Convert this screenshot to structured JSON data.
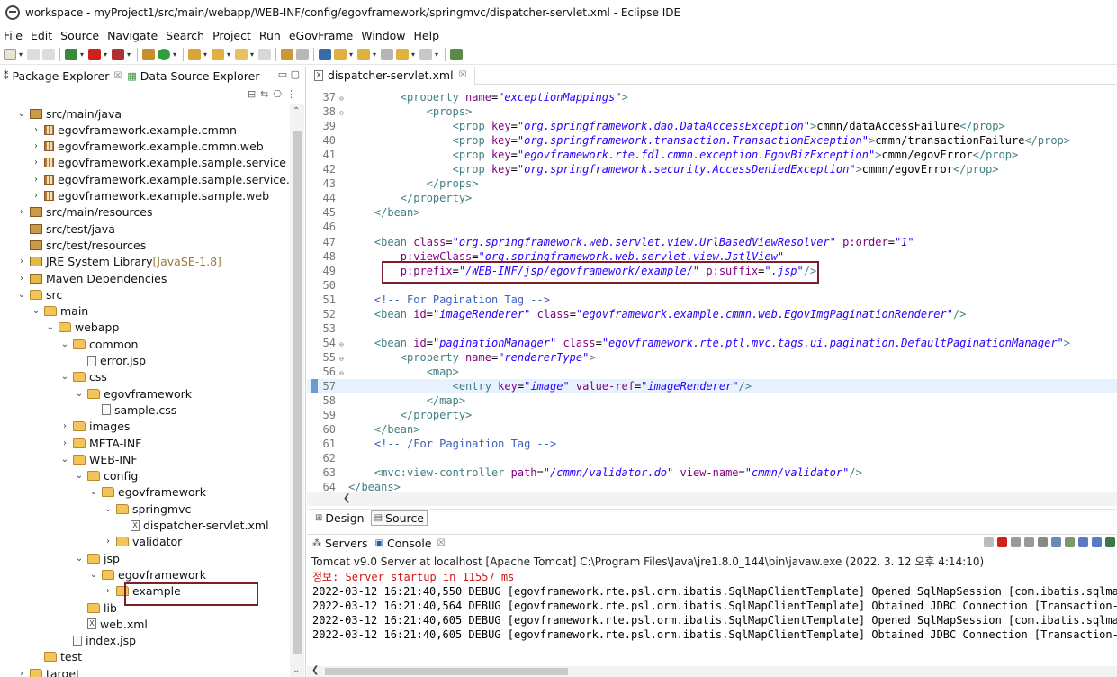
{
  "window": {
    "title": "workspace - myProject1/src/main/webapp/WEB-INF/config/egovframework/springmvc/dispatcher-servlet.xml - Eclipse IDE"
  },
  "menu": [
    "File",
    "Edit",
    "Source",
    "Navigate",
    "Search",
    "Project",
    "Run",
    "eGovFrame",
    "Window",
    "Help"
  ],
  "left_panel": {
    "tabs": [
      {
        "label": "Package Explorer",
        "icon": "package-explorer-icon"
      },
      {
        "label": "Data Source Explorer",
        "icon": "data-source-icon"
      }
    ],
    "tree": [
      {
        "label": "src/main/java",
        "chev": "v",
        "icon": "source-folder",
        "indent": 0
      },
      {
        "label": "egovframework.example.cmmn",
        "chev": ">",
        "icon": "package",
        "indent": 1
      },
      {
        "label": "egovframework.example.cmmn.web",
        "chev": ">",
        "icon": "package",
        "indent": 1
      },
      {
        "label": "egovframework.example.sample.service",
        "chev": ">",
        "icon": "package",
        "indent": 1
      },
      {
        "label": "egovframework.example.sample.service.impl",
        "chev": ">",
        "icon": "package",
        "indent": 1
      },
      {
        "label": "egovframework.example.sample.web",
        "chev": ">",
        "icon": "package",
        "indent": 1
      },
      {
        "label": "src/main/resources",
        "chev": ">",
        "icon": "source-folder",
        "indent": 0
      },
      {
        "label": "src/test/java",
        "chev": "",
        "icon": "source-folder",
        "indent": 0
      },
      {
        "label": "src/test/resources",
        "chev": "",
        "icon": "source-folder",
        "indent": 0
      },
      {
        "label": "JRE System Library",
        "suffix": " [JavaSE-1.8]",
        "chev": ">",
        "icon": "library",
        "indent": 0
      },
      {
        "label": "Maven Dependencies",
        "chev": ">",
        "icon": "library",
        "indent": 0
      },
      {
        "label": "src",
        "chev": "v",
        "icon": "folder",
        "indent": 0
      },
      {
        "label": "main",
        "chev": "v",
        "icon": "folder",
        "indent": 1
      },
      {
        "label": "webapp",
        "chev": "v",
        "icon": "folder",
        "indent": 2
      },
      {
        "label": "common",
        "chev": "v",
        "icon": "folder",
        "indent": 3
      },
      {
        "label": "error.jsp",
        "chev": "",
        "icon": "file",
        "indent": 4
      },
      {
        "label": "css",
        "chev": "v",
        "icon": "folder",
        "indent": 3
      },
      {
        "label": "egovframework",
        "chev": "v",
        "icon": "folder",
        "indent": 4
      },
      {
        "label": "sample.css",
        "chev": "",
        "icon": "file",
        "indent": 5
      },
      {
        "label": "images",
        "chev": ">",
        "icon": "folder",
        "indent": 3
      },
      {
        "label": "META-INF",
        "chev": ">",
        "icon": "folder",
        "indent": 3
      },
      {
        "label": "WEB-INF",
        "chev": "v",
        "icon": "folder",
        "indent": 3
      },
      {
        "label": "config",
        "chev": "v",
        "icon": "folder",
        "indent": 4
      },
      {
        "label": "egovframework",
        "chev": "v",
        "icon": "folder",
        "indent": 5
      },
      {
        "label": "springmvc",
        "chev": "v",
        "icon": "folder",
        "indent": 6
      },
      {
        "label": "dispatcher-servlet.xml",
        "chev": "",
        "icon": "xml",
        "indent": 7
      },
      {
        "label": "validator",
        "chev": ">",
        "icon": "folder",
        "indent": 6
      },
      {
        "label": "jsp",
        "chev": "v",
        "icon": "folder",
        "indent": 4
      },
      {
        "label": "egovframework",
        "chev": "v",
        "icon": "folder",
        "indent": 5
      },
      {
        "label": "example",
        "chev": ">",
        "icon": "folder",
        "indent": 6
      },
      {
        "label": "lib",
        "chev": "",
        "icon": "folder",
        "indent": 4
      },
      {
        "label": "web.xml",
        "chev": "",
        "icon": "xml",
        "indent": 4
      },
      {
        "label": "index.jsp",
        "chev": "",
        "icon": "file",
        "indent": 3
      },
      {
        "label": "test",
        "chev": "",
        "icon": "folder",
        "indent": 1
      },
      {
        "label": "target",
        "chev": ">",
        "icon": "folder",
        "indent": 0
      }
    ]
  },
  "editor": {
    "tab_label": "dispatcher-servlet.xml",
    "lines": [
      {
        "n": "37",
        "fold": "⊖",
        "segs": [
          [
            "code",
            "        "
          ],
          [
            "tag",
            "<property "
          ],
          [
            "attr",
            "name"
          ],
          [
            "code",
            "="
          ],
          [
            "val",
            "\"exceptionMappings\""
          ],
          [
            "tag",
            ">"
          ]
        ]
      },
      {
        "n": "38",
        "fold": "⊖",
        "segs": [
          [
            "code",
            "            "
          ],
          [
            "tag",
            "<props>"
          ]
        ]
      },
      {
        "n": "39",
        "fold": "",
        "segs": [
          [
            "code",
            "                "
          ],
          [
            "tag",
            "<prop "
          ],
          [
            "attr",
            "key"
          ],
          [
            "code",
            "="
          ],
          [
            "val",
            "\"org.springframework.dao.DataAccessException\""
          ],
          [
            "tag",
            ">"
          ],
          [
            "code",
            "cmmn/dataAccessFailure"
          ],
          [
            "tag",
            "</prop>"
          ]
        ]
      },
      {
        "n": "40",
        "fold": "",
        "segs": [
          [
            "code",
            "                "
          ],
          [
            "tag",
            "<prop "
          ],
          [
            "attr",
            "key"
          ],
          [
            "code",
            "="
          ],
          [
            "val",
            "\"org.springframework.transaction.TransactionException\""
          ],
          [
            "tag",
            ">"
          ],
          [
            "code",
            "cmmn/transactionFailure"
          ],
          [
            "tag",
            "</prop>"
          ]
        ]
      },
      {
        "n": "41",
        "fold": "",
        "segs": [
          [
            "code",
            "                "
          ],
          [
            "tag",
            "<prop "
          ],
          [
            "attr",
            "key"
          ],
          [
            "code",
            "="
          ],
          [
            "val",
            "\"egovframework.rte.fdl.cmmn.exception.EgovBizException\""
          ],
          [
            "tag",
            ">"
          ],
          [
            "code",
            "cmmn/egovError"
          ],
          [
            "tag",
            "</prop>"
          ]
        ]
      },
      {
        "n": "42",
        "fold": "",
        "segs": [
          [
            "code",
            "                "
          ],
          [
            "tag",
            "<prop "
          ],
          [
            "attr",
            "key"
          ],
          [
            "code",
            "="
          ],
          [
            "val",
            "\"org.springframework.security.AccessDeniedException\""
          ],
          [
            "tag",
            ">"
          ],
          [
            "code",
            "cmmn/egovError"
          ],
          [
            "tag",
            "</prop>"
          ]
        ]
      },
      {
        "n": "43",
        "fold": "",
        "segs": [
          [
            "code",
            "            "
          ],
          [
            "tag",
            "</props>"
          ]
        ]
      },
      {
        "n": "44",
        "fold": "",
        "segs": [
          [
            "code",
            "        "
          ],
          [
            "tag",
            "</property>"
          ]
        ]
      },
      {
        "n": "45",
        "fold": "",
        "segs": [
          [
            "code",
            "    "
          ],
          [
            "tag",
            "</bean>"
          ]
        ]
      },
      {
        "n": "46",
        "fold": "",
        "segs": [
          [
            "code",
            ""
          ]
        ]
      },
      {
        "n": "47",
        "fold": "",
        "segs": [
          [
            "code",
            "    "
          ],
          [
            "tag",
            "<bean "
          ],
          [
            "attr",
            "class"
          ],
          [
            "code",
            "="
          ],
          [
            "val",
            "\"org.springframework.web.servlet.view.UrlBasedViewResolver\""
          ],
          [
            "code",
            " "
          ],
          [
            "attr",
            "p:order"
          ],
          [
            "code",
            "="
          ],
          [
            "val",
            "\"1\""
          ]
        ]
      },
      {
        "n": "48",
        "fold": "",
        "segs": [
          [
            "code",
            "        "
          ],
          [
            "attr",
            "p:viewClass"
          ],
          [
            "code",
            "="
          ],
          [
            "val",
            "\"org.springframework.web.servlet.view.JstlView\""
          ]
        ]
      },
      {
        "n": "49",
        "fold": "",
        "segs": [
          [
            "code",
            "        "
          ],
          [
            "attr",
            "p:prefix"
          ],
          [
            "code",
            "="
          ],
          [
            "val",
            "\"/WEB-INF/jsp/egovframework/example/\""
          ],
          [
            "code",
            " "
          ],
          [
            "attr",
            "p:suffix"
          ],
          [
            "code",
            "="
          ],
          [
            "val",
            "\".jsp\""
          ],
          [
            "tag",
            "/>"
          ]
        ]
      },
      {
        "n": "50",
        "fold": "",
        "segs": [
          [
            "code",
            ""
          ]
        ]
      },
      {
        "n": "51",
        "fold": "",
        "segs": [
          [
            "code",
            "    "
          ],
          [
            "cmt",
            "<!-- For Pagination Tag -->"
          ]
        ]
      },
      {
        "n": "52",
        "fold": "",
        "segs": [
          [
            "code",
            "    "
          ],
          [
            "tag",
            "<bean "
          ],
          [
            "attr",
            "id"
          ],
          [
            "code",
            "="
          ],
          [
            "val",
            "\"imageRenderer\""
          ],
          [
            "code",
            " "
          ],
          [
            "attr",
            "class"
          ],
          [
            "code",
            "="
          ],
          [
            "val",
            "\"egovframework.example.cmmn.web.EgovImgPaginationRenderer\""
          ],
          [
            "tag",
            "/>"
          ]
        ]
      },
      {
        "n": "53",
        "fold": "",
        "segs": [
          [
            "code",
            ""
          ]
        ]
      },
      {
        "n": "54",
        "fold": "⊖",
        "segs": [
          [
            "code",
            "    "
          ],
          [
            "tag",
            "<bean "
          ],
          [
            "attr",
            "id"
          ],
          [
            "code",
            "="
          ],
          [
            "val",
            "\"paginationManager\""
          ],
          [
            "code",
            " "
          ],
          [
            "attr",
            "class"
          ],
          [
            "code",
            "="
          ],
          [
            "val",
            "\"egovframework.rte.ptl.mvc.tags.ui.pagination.DefaultPaginationManager\""
          ],
          [
            "tag",
            ">"
          ]
        ]
      },
      {
        "n": "55",
        "fold": "⊖",
        "segs": [
          [
            "code",
            "        "
          ],
          [
            "tag",
            "<property "
          ],
          [
            "attr",
            "name"
          ],
          [
            "code",
            "="
          ],
          [
            "val",
            "\"rendererType\""
          ],
          [
            "tag",
            ">"
          ]
        ]
      },
      {
        "n": "56",
        "fold": "⊖",
        "segs": [
          [
            "code",
            "            "
          ],
          [
            "tag",
            "<map>"
          ]
        ]
      },
      {
        "n": "57",
        "fold": "",
        "active": true,
        "segs": [
          [
            "code",
            "                "
          ],
          [
            "tag",
            "<entry "
          ],
          [
            "attr",
            "key"
          ],
          [
            "code",
            "="
          ],
          [
            "val",
            "\"image\""
          ],
          [
            "code",
            " "
          ],
          [
            "attr",
            "value-ref"
          ],
          [
            "code",
            "="
          ],
          [
            "val",
            "\"imageRenderer\""
          ],
          [
            "tag",
            "/>"
          ]
        ]
      },
      {
        "n": "58",
        "fold": "",
        "segs": [
          [
            "code",
            "            "
          ],
          [
            "tag",
            "</map>"
          ]
        ]
      },
      {
        "n": "59",
        "fold": "",
        "segs": [
          [
            "code",
            "        "
          ],
          [
            "tag",
            "</property>"
          ]
        ]
      },
      {
        "n": "60",
        "fold": "",
        "segs": [
          [
            "code",
            "    "
          ],
          [
            "tag",
            "</bean>"
          ]
        ]
      },
      {
        "n": "61",
        "fold": "",
        "segs": [
          [
            "code",
            "    "
          ],
          [
            "cmt",
            "<!-- /For Pagination Tag -->"
          ]
        ]
      },
      {
        "n": "62",
        "fold": "",
        "segs": [
          [
            "code",
            ""
          ]
        ]
      },
      {
        "n": "63",
        "fold": "",
        "segs": [
          [
            "code",
            "    "
          ],
          [
            "tag",
            "<mvc:view-controller "
          ],
          [
            "attr",
            "path"
          ],
          [
            "code",
            "="
          ],
          [
            "val",
            "\"/cmmn/validator.do\""
          ],
          [
            "code",
            " "
          ],
          [
            "attr",
            "view-name"
          ],
          [
            "code",
            "="
          ],
          [
            "val",
            "\"cmmn/validator\""
          ],
          [
            "tag",
            "/>"
          ]
        ]
      },
      {
        "n": "64",
        "fold": "",
        "segs": [
          [
            "tag",
            "</beans>"
          ]
        ]
      }
    ]
  },
  "mode_tabs": {
    "design": "Design",
    "source": "Source"
  },
  "console": {
    "tabs": {
      "servers": "Servers",
      "console": "Console"
    },
    "description": "Tomcat v9.0 Server at localhost [Apache Tomcat] C:\\Program Files\\Java\\jre1.8.0_144\\bin\\javaw.exe  (2022. 3. 12 오후 4:14:10)",
    "lines": [
      {
        "text": "정보: Server startup in 11557 ms",
        "err": true
      },
      {
        "text": "2022-03-12 16:21:40,550 DEBUG [egovframework.rte.psl.orm.ibatis.SqlMapClientTemplate] Opened SqlMapSession [com.ibatis.sqlmap",
        "err": false
      },
      {
        "text": "2022-03-12 16:21:40,564 DEBUG [egovframework.rte.psl.orm.ibatis.SqlMapClientTemplate] Obtained JDBC Connection [Transaction-a",
        "err": false
      },
      {
        "text": "2022-03-12 16:21:40,605 DEBUG [egovframework.rte.psl.orm.ibatis.SqlMapClientTemplate] Opened SqlMapSession [com.ibatis.sqlmap",
        "err": false
      },
      {
        "text": "2022-03-12 16:21:40,605 DEBUG [egovframework.rte.psl.orm.ibatis.SqlMapClientTemplate] Obtained JDBC Connection [Transaction-a",
        "err": false
      }
    ]
  }
}
